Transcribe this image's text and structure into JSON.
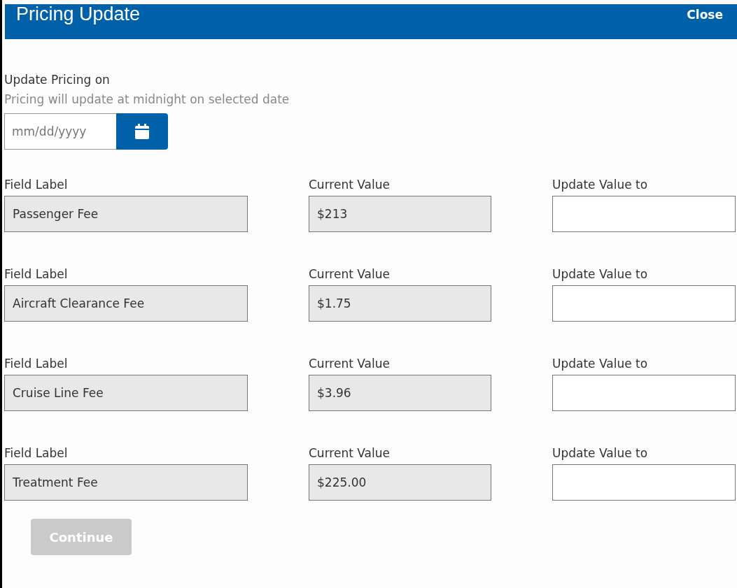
{
  "header": {
    "title": "Pricing Update",
    "close": "Close"
  },
  "date": {
    "label": "Update Pricing on",
    "hint": "Pricing will update at midnight on selected date",
    "placeholder": "mm/dd/yyyy"
  },
  "rows": [
    {
      "label_heading": "Field Label",
      "label": "Passenger Fee",
      "current_heading": "Current Value",
      "current": "$213",
      "update_heading": "Update Value to"
    },
    {
      "label_heading": "Field Label",
      "label": "Aircraft Clearance Fee",
      "current_heading": "Current Value",
      "current": "$1.75",
      "update_heading": "Update Value to"
    },
    {
      "label_heading": "Field Label",
      "label": "Cruise Line Fee",
      "current_heading": "Current Value",
      "current": "$3.96",
      "update_heading": "Update Value to"
    },
    {
      "label_heading": "Field Label",
      "label": "Treatment Fee",
      "current_heading": "Current Value",
      "current": "$225.00",
      "update_heading": "Update Value to"
    }
  ],
  "continue_button": {
    "label": "Continue",
    "disabled": true
  }
}
